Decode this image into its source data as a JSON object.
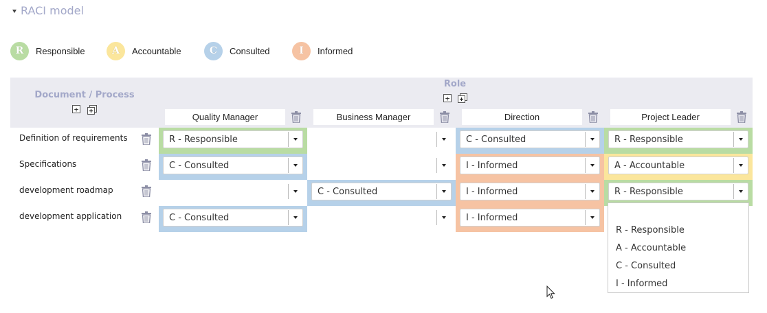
{
  "section": {
    "title": "RACI model"
  },
  "legend": [
    {
      "letter": "R",
      "label": "Responsible",
      "color": "#b9dca3"
    },
    {
      "letter": "A",
      "label": "Accountable",
      "color": "#fbe69c"
    },
    {
      "letter": "C",
      "label": "Consulted",
      "color": "#b6d1e9"
    },
    {
      "letter": "I",
      "label": "Informed",
      "color": "#f6c3a3"
    }
  ],
  "header": {
    "document_title": "Document / Process",
    "role_title": "Role",
    "add_symbol": "+",
    "add_multi_symbol": "+",
    "roles": [
      "Quality Manager",
      "Business Manager",
      "Direction",
      "Project Leader"
    ]
  },
  "rows": [
    {
      "label": "Definition of requirements",
      "cells": [
        "R - Responsible",
        "",
        "C - Consulted",
        "R - Responsible"
      ]
    },
    {
      "label": "Specifications",
      "cells": [
        "C - Consulted",
        "",
        "I - Informed",
        "A - Accountable"
      ]
    },
    {
      "label": "development roadmap",
      "cells": [
        "",
        "C - Consulted",
        "I - Informed",
        "R - Responsible"
      ]
    },
    {
      "label": "development application",
      "cells": [
        "C - Consulted",
        "",
        "I - Informed",
        ""
      ]
    }
  ],
  "dropdown": {
    "options": [
      "",
      "R - Responsible",
      "A - Accountable",
      "C - Consulted",
      "I - Informed"
    ]
  },
  "colors": {
    "R": "#b9dca3",
    "A": "#fbe69c",
    "C": "#b6d1e9",
    "I": "#f6c3a3",
    "title": "#a3a8c9",
    "header_band": "#ebebf1"
  }
}
